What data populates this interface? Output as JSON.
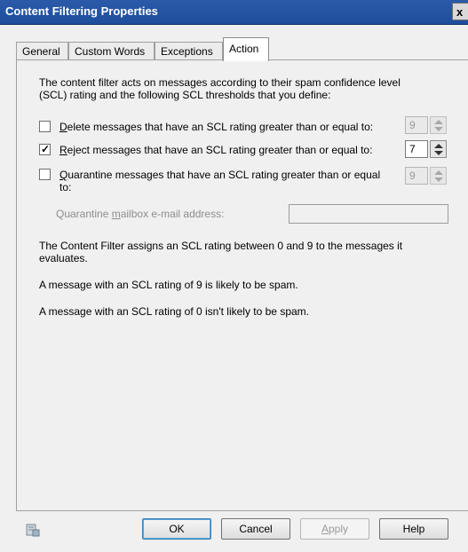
{
  "window": {
    "title": "Content Filtering Properties",
    "close_glyph": "x"
  },
  "tabs": [
    {
      "label": "General",
      "active": false
    },
    {
      "label": "Custom Words",
      "active": false
    },
    {
      "label": "Exceptions",
      "active": false
    },
    {
      "label": "Action",
      "active": true
    }
  ],
  "action": {
    "intro_line1": "The content filter acts on messages according to their spam confidence level",
    "intro_line2": "(SCL) rating and the following SCL thresholds that you define:",
    "delete": {
      "checked": false,
      "mnemonic": "D",
      "label_rest": "elete messages that have an SCL rating greater than or equal to:",
      "value": "9",
      "enabled": false
    },
    "reject": {
      "checked": true,
      "mnemonic": "R",
      "label_rest": "eject messages that have an SCL rating greater than or equal to:",
      "value": "7",
      "enabled": true
    },
    "quarantine": {
      "checked": false,
      "mnemonic": "Q",
      "label_rest_line1": "uarantine messages that have an SCL rating greater than or equal",
      "label_line2": "to:",
      "value": "9",
      "enabled": false
    },
    "quarantine_mailbox": {
      "label_pre": "Quarantine ",
      "mnemonic": "m",
      "label_post": "ailbox e-mail address:",
      "value": ""
    },
    "info_line1": "The Content Filter assigns an SCL rating between 0 and 9 to the messages it",
    "info_line2": "evaluates.",
    "info_spam": "A message with an SCL rating of 9 is likely to be spam.",
    "info_not_spam": "A message with an SCL rating of 0 isn't likely to be spam."
  },
  "footer": {
    "help_icon": "help-context-icon",
    "ok": "OK",
    "cancel": "Cancel",
    "apply": "Apply",
    "help": "Help"
  }
}
